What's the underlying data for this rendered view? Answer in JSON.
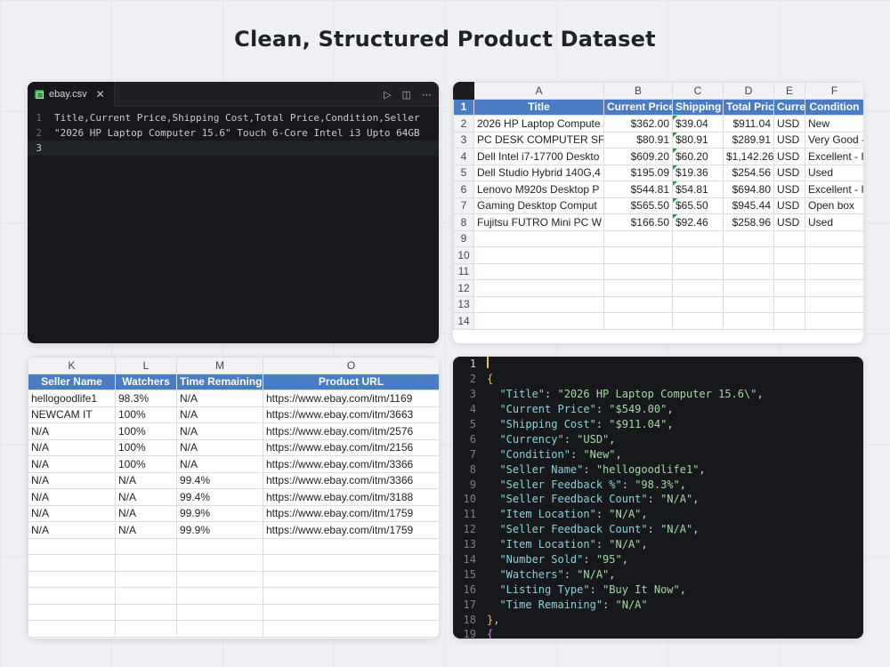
{
  "page": {
    "title": "Clean, Structured Product Dataset"
  },
  "csv_editor": {
    "tab_label": "ebay.csv",
    "lines": [
      {
        "num": "1",
        "text": "Title,Current Price,Shipping Cost,Total Price,Condition,Seller"
      },
      {
        "num": "2",
        "text": " \"2026 HP Laptop Computer 15.6\" Touch 6-Core Intel i3 Upto 64GB"
      },
      {
        "num": "3",
        "text": ""
      }
    ]
  },
  "sheet1": {
    "col_letters": [
      "A",
      "B",
      "C",
      "D",
      "E",
      "F"
    ],
    "headers": [
      "Title",
      "Current Price",
      "Shipping",
      "Total Pric",
      "Curre",
      "Condition"
    ],
    "rows": [
      [
        "2026 HP Laptop Compute",
        "$362.00",
        "$39.04",
        "$911.04",
        "USD",
        "New"
      ],
      [
        "PC DESK COMPUTER SFF F",
        "$80.91",
        "$80.91",
        "$289.91",
        "USD",
        "Very Good -"
      ],
      [
        "Dell Intel i7-17700 Deskto",
        "$609.20",
        "$60.20",
        "$1,142.26",
        "USD",
        "Excellent - I"
      ],
      [
        "Dell Studio Hybrid 140G,4",
        "$195.09",
        "$19.36",
        "$254.56",
        "USD",
        "Used"
      ],
      [
        "Lenovo M920s Desktop P",
        "$544.81",
        "$54.81",
        "$694.80",
        "USD",
        "Excellent - I"
      ],
      [
        "Gaming Desktop Comput",
        "$565.50",
        "$65.50",
        "$945.44",
        "USD",
        "Open box"
      ],
      [
        "Fujitsu FUTRO Mini PC W",
        "$166.50",
        "$92.46",
        "$258.96",
        "USD",
        "Used"
      ]
    ],
    "row_numbers": [
      "1",
      "2",
      "3",
      "4",
      "5",
      "6",
      "7",
      "8",
      "9",
      "10",
      "11",
      "12",
      "13",
      "14"
    ]
  },
  "sheet2": {
    "col_letters": [
      "K",
      "L",
      "M",
      "O"
    ],
    "headers": [
      "Seller Name",
      "Watchers",
      "Time Remaining",
      "Product URL"
    ],
    "rows": [
      [
        "hellogoodlife1",
        "98.3%",
        "N/A",
        "https://www.ebay.com/itm/1169"
      ],
      [
        "NEWCAM IT",
        "100%",
        "N/A",
        "https://www.ebay.com/itm/3663"
      ],
      [
        "N/A",
        "100%",
        "N/A",
        "https://www.ebay.com/itm/2576"
      ],
      [
        "N/A",
        "100%",
        "N/A",
        "https://www.ebay.com/itm/2156"
      ],
      [
        "N/A",
        "100%",
        "N/A",
        "https://www.ebay.com/itm/3366"
      ],
      [
        "N/A",
        "N/A",
        "99.4%",
        "https://www.ebay.com/itm/3366"
      ],
      [
        "N/A",
        "N/A",
        "99.4%",
        "https://www.ebay.com/itm/3188"
      ],
      [
        "N/A",
        "N/A",
        "99.9%",
        "https://www.ebay.com/itm/1759"
      ],
      [
        "N/A",
        "N/A",
        "99.9%",
        "https://www.ebay.com/itm/1759"
      ]
    ]
  },
  "json_editor": {
    "lines": [
      {
        "num": "1",
        "parts": []
      },
      {
        "num": "2",
        "parts": [
          [
            "brace",
            "{"
          ]
        ]
      },
      {
        "num": "3",
        "parts": [
          [
            "pad",
            "  "
          ],
          [
            "key",
            "\"Title\""
          ],
          [
            "punc",
            ": "
          ],
          [
            "str",
            "\"2026 HP Laptop Computer 15.6\\\""
          ],
          [
            "punc",
            ","
          ]
        ]
      },
      {
        "num": "4",
        "parts": [
          [
            "pad",
            "  "
          ],
          [
            "key",
            "\"Current Price\""
          ],
          [
            "punc",
            ": "
          ],
          [
            "str",
            "\"$549.00\""
          ],
          [
            "punc",
            ","
          ]
        ]
      },
      {
        "num": "5",
        "parts": [
          [
            "pad",
            "  "
          ],
          [
            "key",
            "\"Shipping Cost\""
          ],
          [
            "punc",
            ": "
          ],
          [
            "str",
            "\"$911.04\""
          ],
          [
            "punc",
            ","
          ]
        ]
      },
      {
        "num": "6",
        "parts": [
          [
            "pad",
            "  "
          ],
          [
            "key",
            "\"Currency\""
          ],
          [
            "punc",
            ": "
          ],
          [
            "str",
            "\"USD\""
          ],
          [
            "punc",
            ","
          ]
        ]
      },
      {
        "num": "7",
        "parts": [
          [
            "pad",
            "  "
          ],
          [
            "key",
            "\"Condition\""
          ],
          [
            "punc",
            ": "
          ],
          [
            "str",
            "\"New\""
          ],
          [
            "punc",
            ","
          ]
        ]
      },
      {
        "num": "8",
        "parts": [
          [
            "pad",
            "  "
          ],
          [
            "key",
            "\"Seller Name\""
          ],
          [
            "punc",
            ": "
          ],
          [
            "str",
            "\"hellogoodlife1\""
          ],
          [
            "punc",
            ","
          ]
        ]
      },
      {
        "num": "9",
        "parts": [
          [
            "pad",
            "  "
          ],
          [
            "key",
            "\"Seller Feedback %\""
          ],
          [
            "punc",
            ": "
          ],
          [
            "str",
            "\"98.3%\""
          ],
          [
            "punc",
            ","
          ]
        ]
      },
      {
        "num": "10",
        "parts": [
          [
            "pad",
            "  "
          ],
          [
            "key",
            "\"Seller Feedback Count\""
          ],
          [
            "punc",
            ": "
          ],
          [
            "str",
            "\"N/A\""
          ],
          [
            "punc",
            ","
          ]
        ]
      },
      {
        "num": "11",
        "parts": [
          [
            "pad",
            "  "
          ],
          [
            "key",
            "\"Item Location\""
          ],
          [
            "punc",
            ": "
          ],
          [
            "str",
            "\"N/A\""
          ],
          [
            "punc",
            ","
          ]
        ]
      },
      {
        "num": "12",
        "parts": [
          [
            "pad",
            "  "
          ],
          [
            "key",
            "\"Seller Feedback Count\""
          ],
          [
            "punc",
            ": "
          ],
          [
            "str",
            "\"N/A\""
          ],
          [
            "punc",
            ","
          ]
        ]
      },
      {
        "num": "13",
        "parts": [
          [
            "pad",
            "  "
          ],
          [
            "key",
            "\"Item Location\""
          ],
          [
            "punc",
            ": "
          ],
          [
            "str",
            "\"N/A\""
          ],
          [
            "punc",
            ","
          ]
        ]
      },
      {
        "num": "14",
        "parts": [
          [
            "pad",
            "  "
          ],
          [
            "key",
            "\"Number Sold\""
          ],
          [
            "punc",
            ": "
          ],
          [
            "str",
            "\"95\""
          ],
          [
            "punc",
            ","
          ]
        ]
      },
      {
        "num": "15",
        "parts": [
          [
            "pad",
            "  "
          ],
          [
            "key",
            "\"Watchers\""
          ],
          [
            "punc",
            ": "
          ],
          [
            "str",
            "\"N/A\""
          ],
          [
            "punc",
            ","
          ]
        ]
      },
      {
        "num": "16",
        "parts": [
          [
            "pad",
            "  "
          ],
          [
            "key",
            "\"Listing Type\""
          ],
          [
            "punc",
            ": "
          ],
          [
            "str",
            "\"Buy It Now\""
          ],
          [
            "punc",
            ","
          ]
        ]
      },
      {
        "num": "17",
        "parts": [
          [
            "pad",
            "  "
          ],
          [
            "key",
            "\"Time Remaining\""
          ],
          [
            "punc",
            ": "
          ],
          [
            "str",
            "\"N/A\""
          ]
        ]
      },
      {
        "num": "18",
        "parts": [
          [
            "brace",
            "}"
          ],
          [
            "punc",
            ","
          ]
        ]
      },
      {
        "num": "19",
        "parts": [
          [
            "brace2",
            "{"
          ]
        ]
      }
    ]
  }
}
